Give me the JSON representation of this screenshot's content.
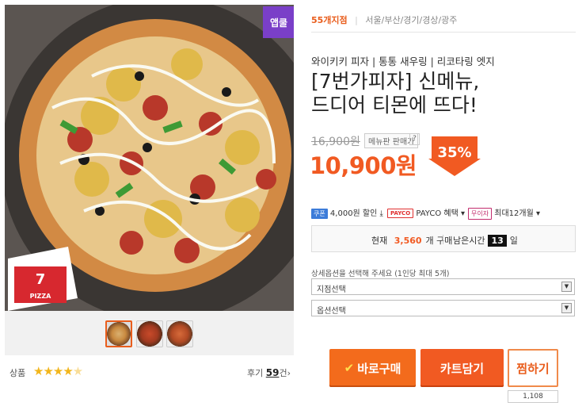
{
  "product": {
    "badge": "앱쿨",
    "location": {
      "label": "55개지점",
      "cities": "서울/부산/경기/경상/광주"
    },
    "subtitle": "와이키키 피자 | 통통 새우링 | 리코타링 엣지",
    "title_line1": "[7번가피자] 신메뉴,",
    "title_line2": "드디어 티몬에 뜨다!",
    "logo_text": "7th PIZZA"
  },
  "price": {
    "original": "16,900원",
    "menu_price_label": "메뉴판 판매가",
    "help": "?",
    "sale": "10,900원",
    "discount": "35%"
  },
  "benefits": {
    "coupon_tag": "쿠폰",
    "coupon_text": "4,000원 할인",
    "coupon_icon": "download-icon",
    "payco_tag": "PAYCO",
    "payco_text": "PAYCO 혜택",
    "nointerest_tag": "무이자",
    "nointerest_text": "최대12개월"
  },
  "status": {
    "now_label": "현재",
    "buyers": "3,560",
    "buyers_suffix": "개 구매",
    "remain_label": "남은시간",
    "days": "13",
    "days_suffix": "일"
  },
  "options": {
    "label": "상세옵션을 선택해 주세요 (1인당 최대 5개)",
    "select1": "지점선택",
    "select2": "옵션선택",
    "arrow": "▼"
  },
  "rating": {
    "label": "상품",
    "stars": 4.5,
    "review_label": "후기",
    "review_count": "59",
    "review_suffix": "건"
  },
  "buttons": {
    "buy": "바로구매",
    "cart": "카트담기",
    "wish": "찜하기",
    "wish_count": "1,108"
  },
  "colors": {
    "accent": "#f15a22",
    "badge": "#7a3fc8",
    "coupon": "#3c7cd9"
  }
}
